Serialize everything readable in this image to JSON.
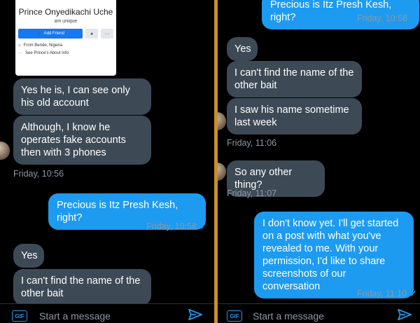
{
  "left": {
    "profile": {
      "name": "Prince Onyedikachi Uche",
      "bio": "am unique",
      "add_friend": "Add Friend",
      "from": "From Bende, Nigeria",
      "about": "See Prince's About Info"
    },
    "messages": [
      {
        "text": "Yes he is, I can see only his old account"
      },
      {
        "text": "Although, I know he operates fake accounts then with 3 phones"
      },
      {
        "time": "Friday, 10:56"
      },
      {
        "text": "Precious is Itz Presh Kesh, right?"
      },
      {
        "time": "Friday, 10:58"
      },
      {
        "text": "Yes"
      },
      {
        "text": "I can't find the name of the other bait"
      }
    ],
    "composer": {
      "gif": "GIF",
      "placeholder": "Start a message"
    }
  },
  "right": {
    "messages": [
      {
        "text": "Precious is Itz Presh Kesh, right?"
      },
      {
        "time": "Friday, 10:58"
      },
      {
        "text": "Yes"
      },
      {
        "text": "I can't find the name of the other bait"
      },
      {
        "text": "I saw his name sometime last week"
      },
      {
        "time": "Friday, 11:06"
      },
      {
        "text": "So any other thing?"
      },
      {
        "time": "Friday, 11:07"
      },
      {
        "text": "I don't know yet. I'll get started on a post with what you've revealed to me. With your permission, I'd like to share screenshots of our conversation"
      },
      {
        "time": "Friday, 11:10"
      }
    ],
    "composer": {
      "gif": "GIF",
      "placeholder": "Start a message"
    }
  },
  "colors": {
    "sent": "#1d9bf0",
    "received": "#3d4a56",
    "divider": "#c8902a"
  },
  "icons": [
    "add-friend-icon",
    "messenger-icon",
    "more-icon",
    "home-icon",
    "info-icon",
    "read-check-icon",
    "gif-icon",
    "send-icon"
  ]
}
